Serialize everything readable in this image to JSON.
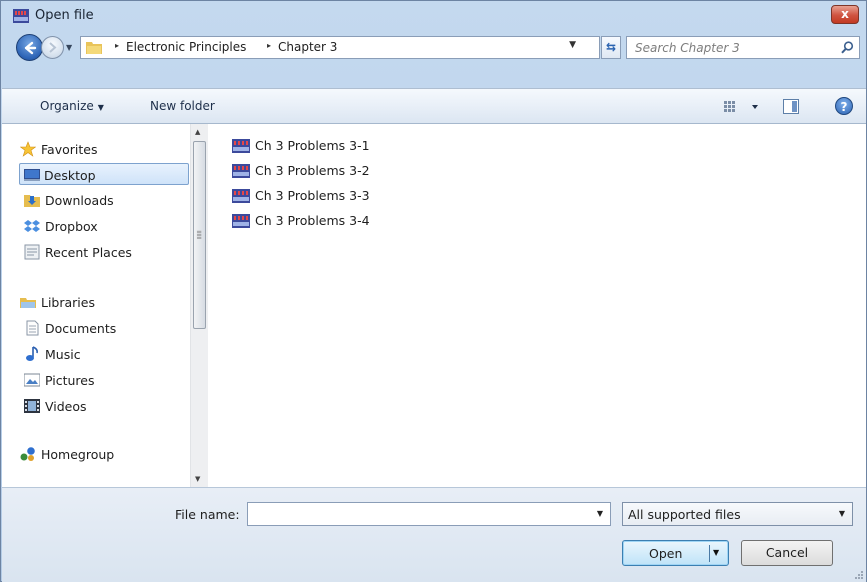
{
  "window": {
    "title": "Open file",
    "close_label": "x"
  },
  "address": {
    "crumbs": [
      "Electronic Principles",
      "Chapter 3"
    ],
    "separator": "▸"
  },
  "search": {
    "placeholder": "Search Chapter 3"
  },
  "toolbar": {
    "organize": "Organize",
    "new_folder": "New folder",
    "help": "?"
  },
  "sidebar": {
    "items": [
      {
        "label": "Favorites",
        "icon": "star-icon"
      },
      {
        "label": "Desktop",
        "icon": "desktop-icon",
        "selected": true
      },
      {
        "label": "Downloads",
        "icon": "downloads-icon"
      },
      {
        "label": "Dropbox",
        "icon": "dropbox-icon"
      },
      {
        "label": "Recent Places",
        "icon": "recent-places-icon"
      },
      {
        "label": "Libraries",
        "icon": "libraries-icon"
      },
      {
        "label": "Documents",
        "icon": "documents-icon"
      },
      {
        "label": "Music",
        "icon": "music-icon"
      },
      {
        "label": "Pictures",
        "icon": "pictures-icon"
      },
      {
        "label": "Videos",
        "icon": "videos-icon"
      },
      {
        "label": "Homegroup",
        "icon": "homegroup-icon"
      }
    ]
  },
  "files": [
    {
      "name": "Ch 3 Problems 3-1"
    },
    {
      "name": "Ch 3 Problems 3-2"
    },
    {
      "name": "Ch 3 Problems 3-3"
    },
    {
      "name": "Ch 3 Problems 3-4"
    }
  ],
  "footer": {
    "file_name_label": "File name:",
    "file_name_value": "",
    "file_type": "All supported files",
    "open_label": "Open",
    "cancel_label": "Cancel"
  },
  "colors": {
    "accent": "#2d64b6",
    "selection": "#cfe3f9"
  }
}
